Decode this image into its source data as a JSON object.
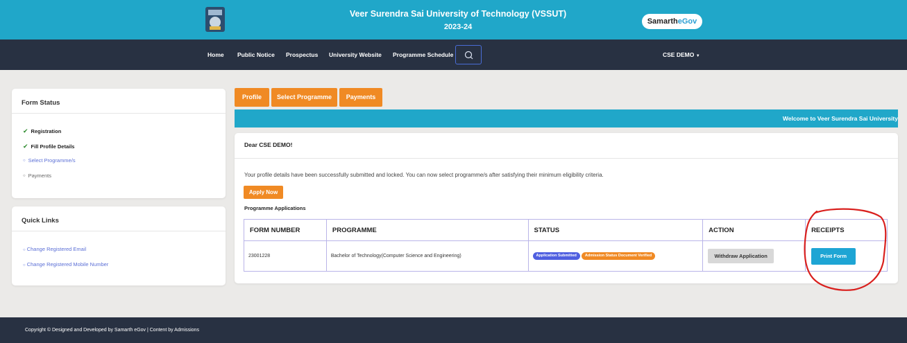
{
  "header": {
    "title": "Veer Surendra Sai University of Technology (VSSUT)",
    "year": "2023-24",
    "badge_samarth": "Samarth",
    "badge_egov": "eGov"
  },
  "nav": {
    "items": [
      "Home",
      "Public Notice",
      "Prospectus",
      "University Website",
      "Programme Schedule"
    ],
    "user": "CSE DEMO"
  },
  "form_status": {
    "title": "Form Status",
    "items": [
      "Registration",
      "Fill Profile Details",
      "Select Programme/s",
      "Payments"
    ]
  },
  "quick_links": {
    "title": "Quick Links",
    "items": [
      "Change Registered Email",
      "Change Registered Mobile Number"
    ]
  },
  "tabs": [
    "Profile",
    "Select Programme",
    "Payments"
  ],
  "welcome": "Welcome to Veer Surendra Sai University",
  "main": {
    "greeting": "Dear CSE DEMO!",
    "message": "Your profile details have been successfully submitted and locked. You can now select programme/s after satisfying their minimum eligibility criteria.",
    "apply_label": "Apply Now",
    "applications_label": "Programme Applications"
  },
  "table": {
    "headers": [
      "FORM NUMBER",
      "PROGRAMME",
      "STATUS",
      "ACTION",
      "RECEIPTS"
    ],
    "row": {
      "form_number": "23001228",
      "programme": "Bachelor of Technology(Computer Science and Engineering)",
      "status_1": "Application Submitted",
      "status_2": "Admission Status Document Verified",
      "action": "Withdraw Application",
      "receipt": "Print Form"
    }
  },
  "footer": "Copyright © Designed and Developed by Samarth eGov | Content by Admissions",
  "colors": {
    "header_bg": "#20a7c9",
    "nav_bg": "#283142",
    "accent_orange": "#f08a24",
    "print_button": "#1ea5d4",
    "annotation_red": "#d9201e"
  }
}
